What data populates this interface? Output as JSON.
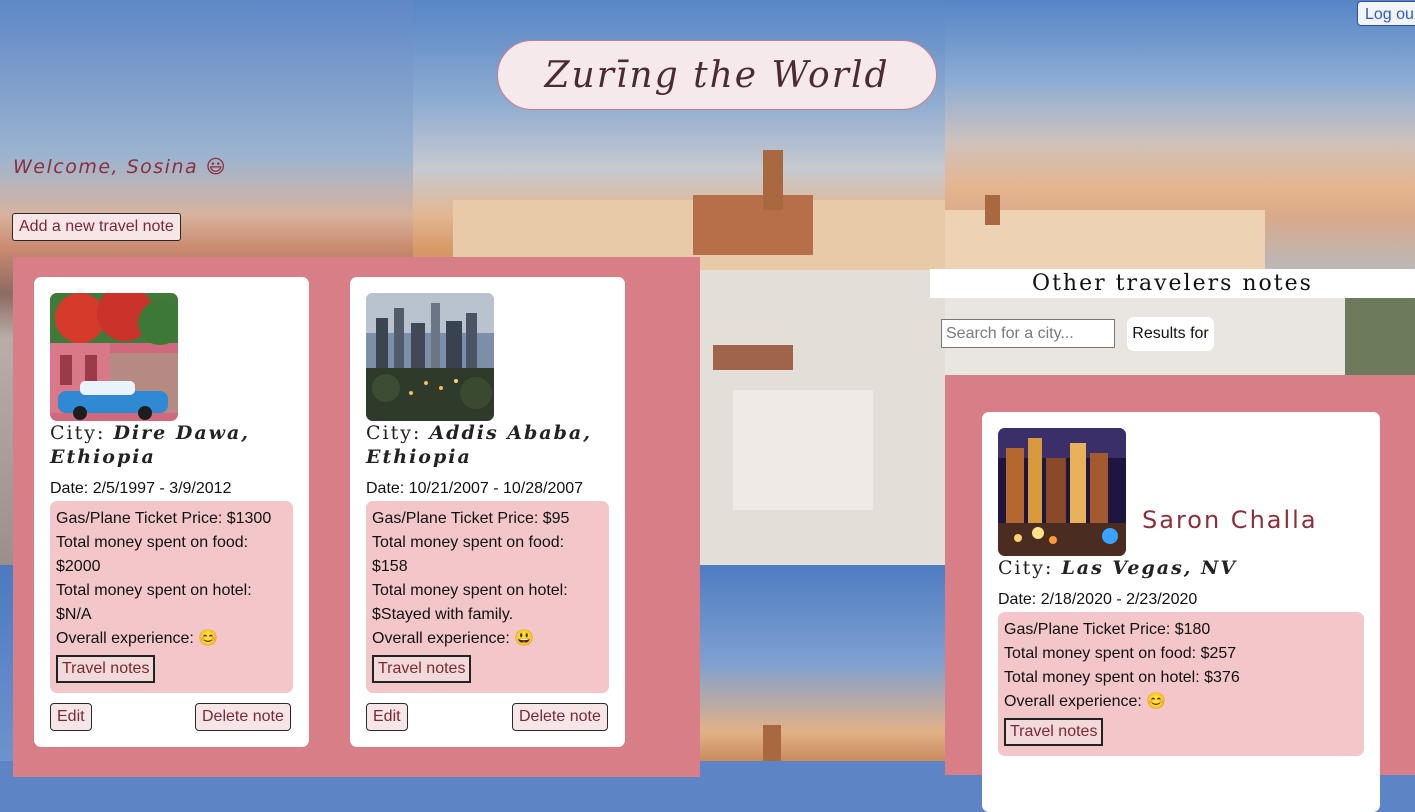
{
  "header": {
    "title": "Zurīng the World",
    "logout_label": "Log ou",
    "welcome": "Welcome, Sosina 😃",
    "add_note_label": "Add a new travel note"
  },
  "my_notes": [
    {
      "city_prefix": "City: ",
      "city": "Dire Dawa, Ethiopia",
      "date": "Date: 2/5/1997 - 3/9/2012",
      "ticket": "Gas/Plane Ticket Price: $1300",
      "food_label": "Total money spent on food:",
      "food_value": "$2000",
      "hotel_label": "Total money spent on hotel:",
      "hotel_value": "$N/A",
      "experience": "Overall experience: 😊",
      "notes_label": "Travel notes",
      "edit_label": "Edit",
      "delete_label": "Delete note"
    },
    {
      "city_prefix": "City: ",
      "city": "Addis Ababa, Ethiopia",
      "date": "Date: 10/21/2007 - 10/28/2007",
      "ticket": "Gas/Plane Ticket Price: $95",
      "food_label": "Total money spent on food:",
      "food_value": "$158",
      "hotel_label": "Total money spent on hotel:",
      "hotel_value": "$Stayed with family.",
      "experience": "Overall experience: 😃",
      "notes_label": "Travel notes",
      "edit_label": "Edit",
      "delete_label": "Delete note"
    }
  ],
  "others": {
    "header": "Other travelers notes",
    "search_placeholder": "Search for a city...",
    "results_label": "Results for",
    "notes": [
      {
        "owner": "Saron Challa",
        "city_prefix": "City: ",
        "city": "Las Vegas, NV",
        "date": "Date: 2/18/2020 - 2/23/2020",
        "ticket": "Gas/Plane Ticket Price: $180",
        "food": "Total money spent on food: $257",
        "hotel": "Total money spent on hotel: $376",
        "experience": "Overall experience: 😊",
        "notes_label": "Travel notes"
      }
    ]
  }
}
